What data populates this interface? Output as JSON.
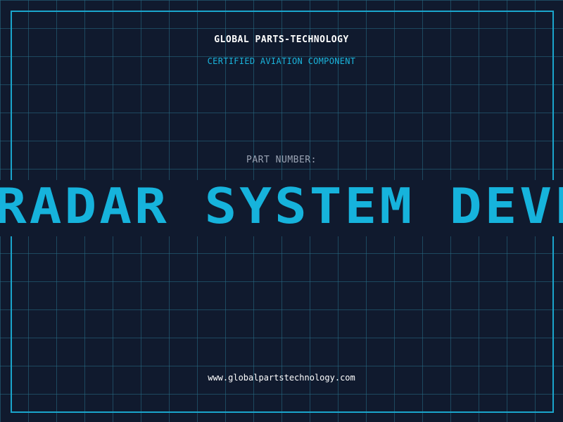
{
  "header": {
    "brand": "GLOBAL PARTS-TECHNOLOGY",
    "subtitle": "CERTIFIED AVIATION COMPONENT"
  },
  "part": {
    "label": "PART NUMBER:",
    "number": "RADAR SYSTEM DEVEL"
  },
  "footer": {
    "url": "www.globalpartstechnology.com"
  },
  "colors": {
    "background": "#101a2e",
    "grid": "#286e87",
    "frame": "#1aa5cc",
    "accent": "#16b3dc",
    "muted": "#9aa3b3",
    "text": "#ffffff"
  }
}
